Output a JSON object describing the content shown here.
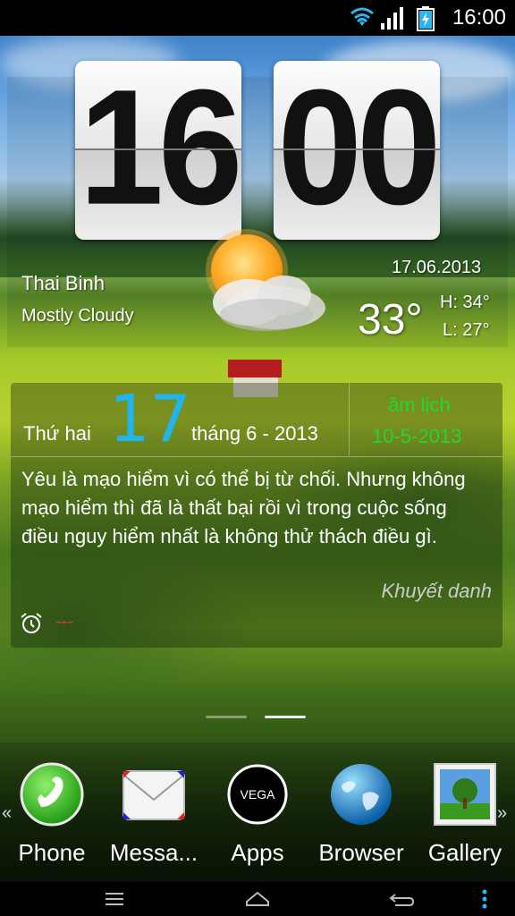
{
  "status_bar": {
    "time": "16:00"
  },
  "clock": {
    "hours": "16",
    "minutes": "00"
  },
  "weather": {
    "city": "Thai Binh",
    "condition": "Mostly Cloudy",
    "date": "17.06.2013",
    "temperature": "33°",
    "high": "H: 34°",
    "low": "L: 27°",
    "icon": "partly-cloudy-icon"
  },
  "calendar": {
    "weekday": "Thứ hai",
    "day": "17",
    "month_year": "tháng 6 - 2013",
    "lunar_label": "âm lịch",
    "lunar_date": "10-5-2013",
    "quote": "Yêu là mạo hiểm vì có thể bị từ chối. Nhưng không mạo hiểm thì đã là thất bại rồi vì trong cuộc sống điều nguy hiểm nhất là không thử thách điều gì.",
    "author": "Khuyết danh",
    "alarm_text": "---",
    "accent_day": "#1fb6f0",
    "accent_lunar": "#23d635"
  },
  "dock": {
    "apps": [
      {
        "label": "Phone",
        "icon": "phone-icon"
      },
      {
        "label": "Messa...",
        "icon": "messaging-icon"
      },
      {
        "label": "Apps",
        "icon": "vega-apps-icon"
      },
      {
        "label": "Browser",
        "icon": "globe-icon"
      },
      {
        "label": "Gallery",
        "icon": "gallery-icon"
      }
    ],
    "left_arrow": "«",
    "right_arrow": "»"
  },
  "nav_bar": {
    "buttons": [
      "menu-icon",
      "home-icon",
      "back-icon",
      "more-icon"
    ]
  }
}
